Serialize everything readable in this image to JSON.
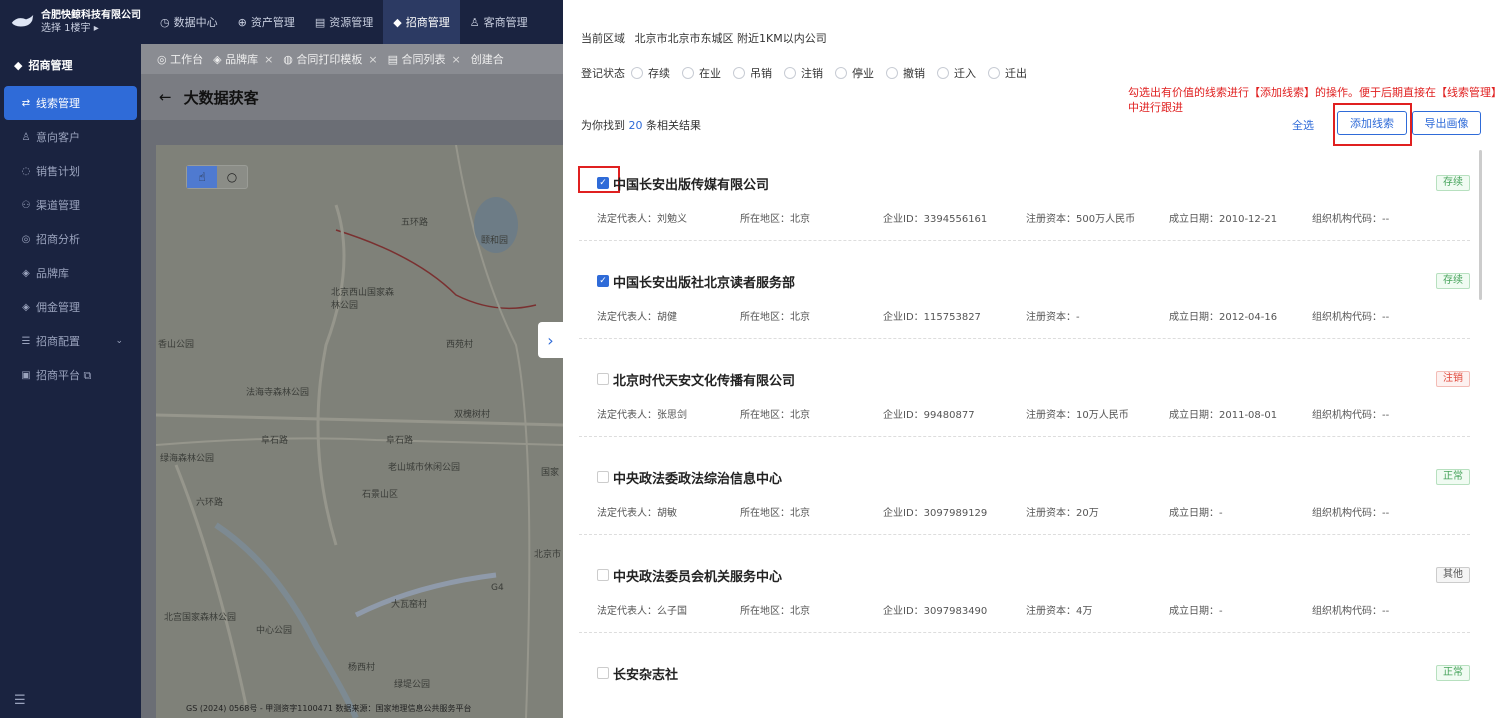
{
  "app": {
    "company": "合肥快鲸科技有限公司",
    "floor": "选择 1楼宇 ▸"
  },
  "topnav": [
    {
      "icon": "◷",
      "label": "数据中心"
    },
    {
      "icon": "⊕",
      "label": "资产管理"
    },
    {
      "icon": "▤",
      "label": "资源管理"
    },
    {
      "icon": "◆",
      "label": "招商管理"
    },
    {
      "icon": "♙",
      "label": "客商管理"
    }
  ],
  "sidebar": {
    "header": "招商管理",
    "items": [
      {
        "icon": "⇄",
        "label": "线索管理"
      },
      {
        "icon": "♙",
        "label": "意向客户"
      },
      {
        "icon": "◌",
        "label": "销售计划"
      },
      {
        "icon": "⚇",
        "label": "渠道管理"
      },
      {
        "icon": "◎",
        "label": "招商分析"
      },
      {
        "icon": "◈",
        "label": "品牌库"
      },
      {
        "icon": "◈",
        "label": "佣金管理"
      },
      {
        "icon": "☰",
        "label": "招商配置"
      },
      {
        "icon": "▣",
        "label": "招商平台 ⧉"
      }
    ],
    "bottom_icon": "☰"
  },
  "tabs": [
    {
      "icon": "◎",
      "label": "工作台"
    },
    {
      "icon": "◈",
      "label": "品牌库"
    },
    {
      "icon": "◍",
      "label": "合同打印模板"
    },
    {
      "icon": "▤",
      "label": "合同列表"
    },
    {
      "icon": "",
      "label": "创建合"
    }
  ],
  "page": {
    "back": "←",
    "title": "大数据获客"
  },
  "map": {
    "labels": [
      "五环路",
      "颐和园",
      "北京西山国家森林公园",
      "香山公园",
      "西苑村",
      "法海寺森林公园",
      "双槐树村",
      "阜石路",
      "阜石路",
      "老山城市休闲公园",
      "绿海森林公园",
      "石景山区",
      "六环路",
      "国家",
      "北京市",
      "北宫国家森林公园",
      "中心公园",
      "大瓦窑村",
      "G4",
      "杨西村",
      "绿堤公园"
    ],
    "footer": "GS (2024) 0568号 - 甲测资字1100471  数据来源：国家地理信息公共服务平台"
  },
  "drawer": {
    "region_label": "当前区域",
    "region_value": "北京市北京市东城区 附近1KM以内公司",
    "status_label": "登记状态",
    "statuses": [
      "存续",
      "在业",
      "吊销",
      "注销",
      "停业",
      "撤销",
      "迁入",
      "迁出"
    ],
    "found_prefix": "为你找到",
    "found_count": "20",
    "found_suffix": "条相关结果",
    "select_all": "全选",
    "add_lead": "添加线索",
    "export": "导出画像",
    "annotation": "勾选出有价值的线索进行【添加线索】的操作。便于后期直接在【线索管理】中进行跟进"
  },
  "field_labels": {
    "legal": "法定代表人：",
    "area": "所在地区：",
    "id": "企业ID：",
    "capital": "注册资本：",
    "date": "成立日期：",
    "org": "组织机构代码："
  },
  "companies": [
    {
      "name": "中国长安出版传媒有限公司",
      "checked": true,
      "tag": "存续",
      "legal": "刘勉义",
      "area": "北京",
      "id": "3394556161",
      "capital": "500万人民币",
      "date": "2010-12-21",
      "org": "--"
    },
    {
      "name": "中国长安出版社北京读者服务部",
      "checked": true,
      "tag": "存续",
      "legal": "胡健",
      "area": "北京",
      "id": "115753827",
      "capital": "-",
      "date": "2012-04-16",
      "org": "--"
    },
    {
      "name": "北京时代天安文化传播有限公司",
      "checked": false,
      "tag": "注销",
      "legal": "张思剑",
      "area": "北京",
      "id": "99480877",
      "capital": "10万人民币",
      "date": "2011-08-01",
      "org": "--"
    },
    {
      "name": "中央政法委政法综治信息中心",
      "checked": false,
      "tag": "正常",
      "legal": "胡敏",
      "area": "北京",
      "id": "3097989129",
      "capital": "20万",
      "date": "-",
      "org": "--"
    },
    {
      "name": "中央政法委员会机关服务中心",
      "checked": false,
      "tag": "其他",
      "legal": "么子国",
      "area": "北京",
      "id": "3097983490",
      "capital": "4万",
      "date": "-",
      "org": "--"
    },
    {
      "name": "长安杂志社",
      "checked": false,
      "tag": "正常",
      "legal": "",
      "area": "",
      "id": "",
      "capital": "",
      "date": "",
      "org": ""
    }
  ],
  "colors": {
    "primary": "#2f6bd8",
    "nav_bg": "#1a2340",
    "annotation": "#e02020"
  }
}
